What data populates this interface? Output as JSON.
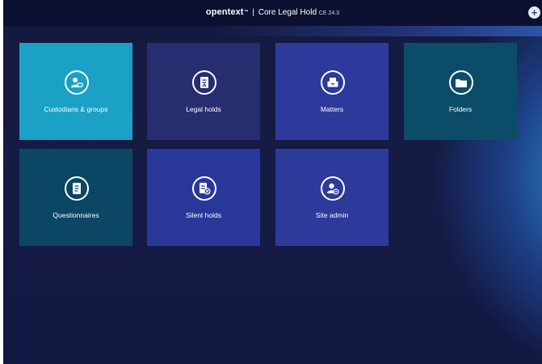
{
  "header": {
    "logo": "opentext",
    "trademark": "™",
    "separator": "|",
    "product": "Core Legal Hold",
    "version": "CE 24.3",
    "add_label": "+"
  },
  "tiles": [
    {
      "label": "Custodians & groups",
      "icon": "custodians-icon",
      "color": "#1ba1c5"
    },
    {
      "label": "Legal holds",
      "icon": "legal-holds-icon",
      "color": "#262e70"
    },
    {
      "label": "Matters",
      "icon": "matters-icon",
      "color": "#2d3a9c"
    },
    {
      "label": "Folders",
      "icon": "folder-icon",
      "color": "#0b4d68"
    },
    {
      "label": "Questionnaires",
      "icon": "questionnaire-icon",
      "color": "#0b4664"
    },
    {
      "label": "Silent holds",
      "icon": "silent-holds-icon",
      "color": "#2a379a"
    },
    {
      "label": "Site admin",
      "icon": "site-admin-icon",
      "color": "#2d3a9c"
    }
  ]
}
